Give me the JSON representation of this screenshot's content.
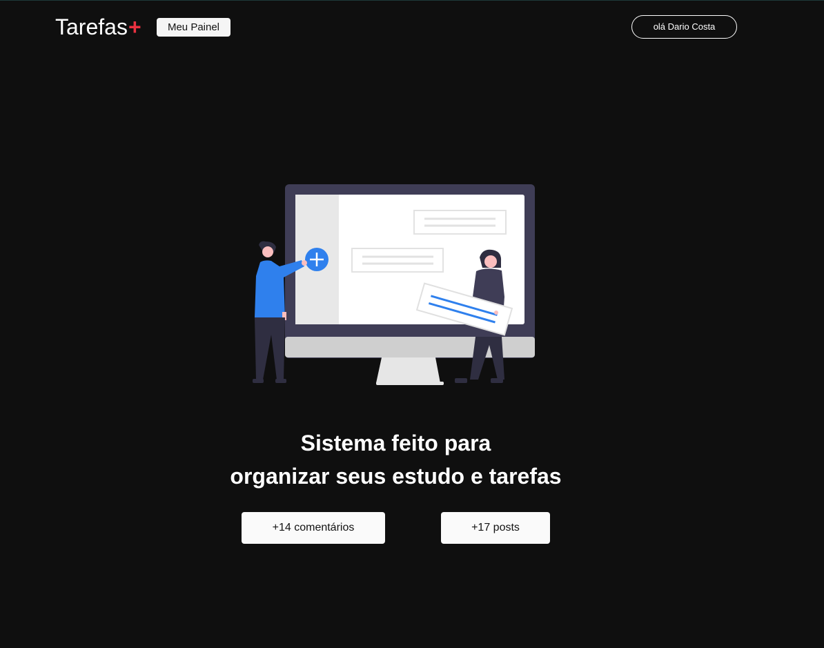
{
  "header": {
    "brand_name": "Tarefas",
    "brand_suffix": "+",
    "panel_link": "Meu Painel",
    "user_greeting": "olá Dario Costa"
  },
  "hero": {
    "illustration_icon": "plus-circle-icon"
  },
  "headline": {
    "line1": "Sistema feito para",
    "line2": "organizar seus estudo e tarefas"
  },
  "stats": {
    "comments": "+14 comentários",
    "posts": "+17 posts"
  },
  "colors": {
    "background": "#0f0f0f",
    "accent_red": "#ea3140",
    "accent_blue": "#3b82f6",
    "button_bg": "#fafafa"
  }
}
